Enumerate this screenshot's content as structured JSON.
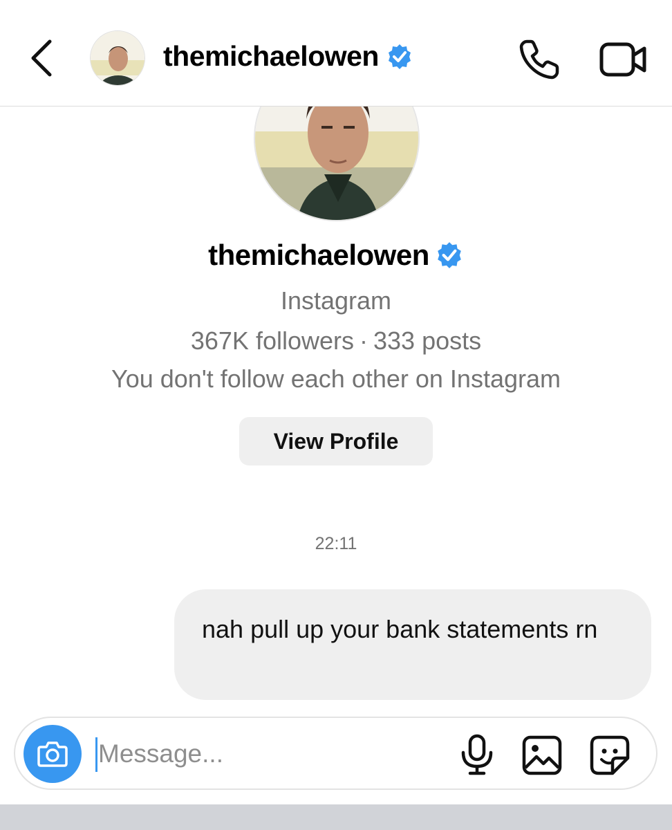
{
  "header": {
    "username": "themichaelowen",
    "verified": true
  },
  "profile": {
    "username": "themichaelowen",
    "verified": true,
    "app": "Instagram",
    "followers": "367K followers",
    "separator": "·",
    "posts": "333 posts",
    "relationship": "You don't follow each other on Instagram",
    "view_profile_label": "View Profile"
  },
  "conversation": {
    "timestamp": "22:11",
    "messages": [
      {
        "sender": "me",
        "text": "nah pull up your bank statements rn"
      }
    ]
  },
  "composer": {
    "placeholder": "Message...",
    "value": ""
  },
  "icons": {
    "back": "chevron-left-icon",
    "call": "phone-icon",
    "video": "video-camera-icon",
    "verified": "verified-badge-icon",
    "camera": "camera-icon",
    "mic": "microphone-icon",
    "gallery": "image-icon",
    "sticker": "sticker-icon"
  },
  "colors": {
    "accent": "#3897f0",
    "verified": "#3897f0",
    "secondary_text": "#737373",
    "bubble_bg": "#efefef"
  }
}
